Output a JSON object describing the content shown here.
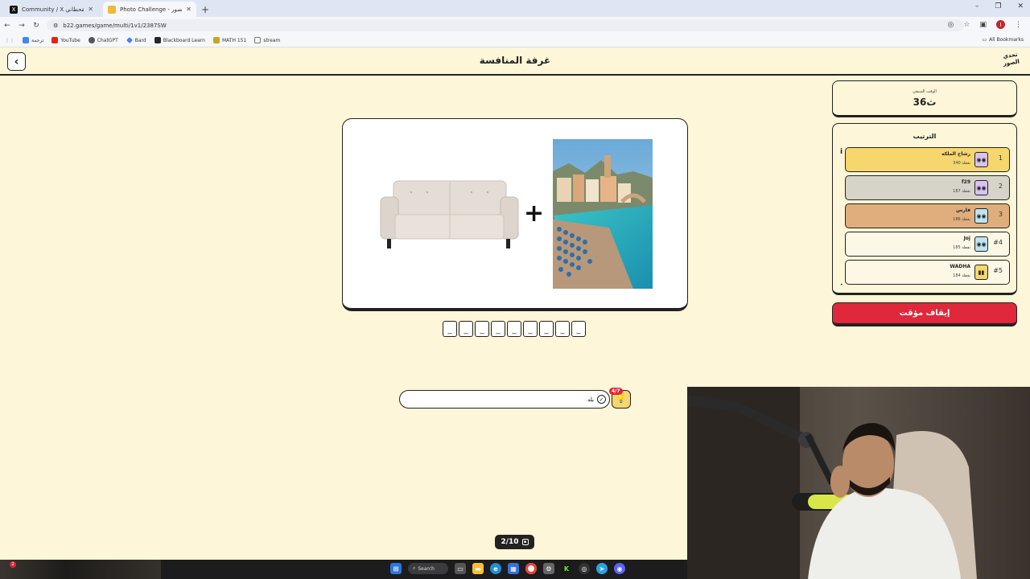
{
  "browser": {
    "tabs": [
      {
        "title": "Community / X الوليد القحطاني",
        "favicon": "x-logo",
        "active": false
      },
      {
        "title": "Photo Challenge - تحدي الصور",
        "favicon": "game-favicon",
        "active": true
      }
    ],
    "new_tab": "+",
    "window_controls": {
      "minimize": "–",
      "restore": "❐",
      "close": "✕"
    },
    "url": "b22.games/game/multi/1v1/2387SW",
    "bookmarks": [
      {
        "label": "ترجمة",
        "icon": "translate-icon",
        "color": "#4285f4"
      },
      {
        "label": "YouTube",
        "icon": "youtube-icon",
        "color": "#e62117"
      },
      {
        "label": "ChatGPT",
        "icon": "chatgpt-icon",
        "color": "#555555"
      },
      {
        "label": "Bard",
        "icon": "bard-icon",
        "color": "#4285f4"
      },
      {
        "label": "Blackboard Learn",
        "icon": "blackboard-icon",
        "color": "#262626"
      },
      {
        "label": "MATH 151",
        "icon": "math-icon",
        "color": "#c9a227"
      },
      {
        "label": "stream",
        "icon": "folder-icon",
        "color": "#777777"
      }
    ],
    "all_bookmarks": "All Bookmarks",
    "profile_initial": "I"
  },
  "game": {
    "room_title": "غرفة المنافسة",
    "logo_text": "تحدي الصور",
    "back_icon": "‹",
    "plus_symbol": "+",
    "slots": [
      "_",
      "_",
      "_",
      "_",
      "_",
      "_",
      "_",
      "_",
      "_"
    ],
    "answer_value": "بلد",
    "hint_badge": "4/7",
    "hint_icon": "lightbulb-icon",
    "progress": "2/10"
  },
  "sidebar": {
    "timer_label": "الوقت المتبقي",
    "timer_value": "36ث",
    "ranking_title": "الترتيب",
    "players": [
      {
        "rank": "1",
        "name": "رشاح الملكه",
        "points": "340 نقطة",
        "color": "#f5d76e"
      },
      {
        "rank": "2",
        "name": "f29",
        "points": "187 نقطة",
        "color": "#d6d3c9"
      },
      {
        "rank": "3",
        "name": "فارس",
        "points": "186 نقطة",
        "color": "#dfae7c"
      },
      {
        "rank": "#4",
        "name": "Joj",
        "points": "185 نقطة",
        "color": "#fdf8e6"
      },
      {
        "rank": "#5",
        "name": "WADHA",
        "points": "184 نقطة",
        "color": "#fdf8e6"
      }
    ],
    "stop_timer_button": "إيقاف مؤقت"
  },
  "taskbar": {
    "search_label": "Search",
    "notification_count": "2"
  }
}
